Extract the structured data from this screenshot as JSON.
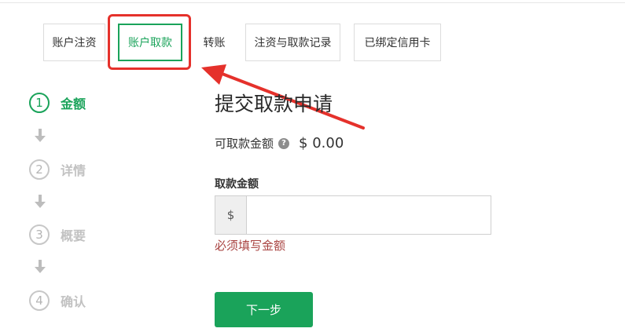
{
  "tabs": [
    {
      "label": "账户注资",
      "active": false
    },
    {
      "label": "账户取款",
      "active": true
    },
    {
      "label": "转账",
      "active": false
    },
    {
      "label": "注资与取款记录",
      "active": false
    },
    {
      "label": "已绑定信用卡",
      "active": false
    }
  ],
  "steps": [
    {
      "num": "1",
      "label": "金额",
      "active": true
    },
    {
      "num": "2",
      "label": "详情",
      "active": false
    },
    {
      "num": "3",
      "label": "概要",
      "active": false
    },
    {
      "num": "4",
      "label": "确认",
      "active": false
    }
  ],
  "main": {
    "title": "提交取款申请",
    "available_label": "可取款金额",
    "available_value": "$ 0.00",
    "help_icon": "help-icon",
    "amount_label": "取款金额",
    "currency_symbol": "$",
    "amount_value": "",
    "error": "必须填写金额",
    "next_button": "下一步"
  },
  "colors": {
    "accent": "#1aa35a",
    "annotation": "#e5312b",
    "error": "#a94442"
  }
}
